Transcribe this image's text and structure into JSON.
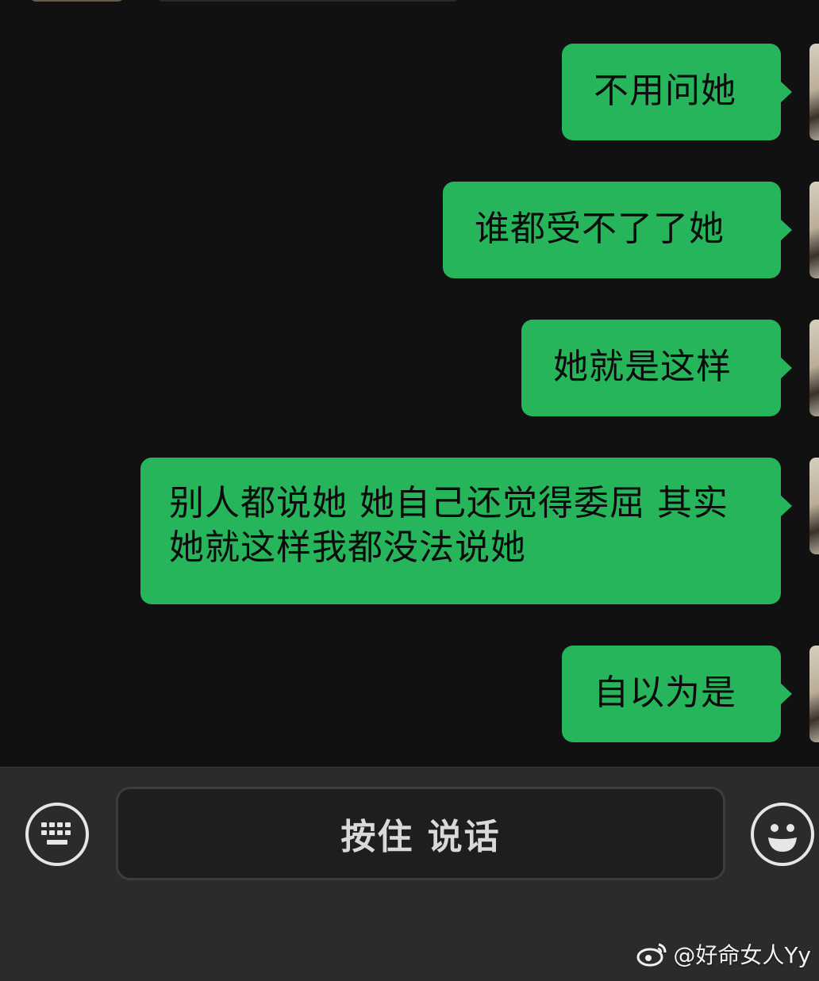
{
  "chat": {
    "messages": [
      {
        "text": "不用问她",
        "sender": "self"
      },
      {
        "text": "谁都受不了了她",
        "sender": "self"
      },
      {
        "text": "她就是这样",
        "sender": "self"
      },
      {
        "text": "别人都说她 她自己还觉得委屈 其实她就这样我都没法说她",
        "sender": "self"
      },
      {
        "text": "自以为是",
        "sender": "self"
      }
    ]
  },
  "input_bar": {
    "keyboard_icon": "keyboard-icon",
    "hold_to_talk_label": "按住 说话",
    "emoji_icon": "smiley-icon"
  },
  "watermark": {
    "text": "@好命女人Yy",
    "icon": "weibo-logo-icon"
  },
  "colors": {
    "background": "#111111",
    "bubble_self": "#26b55b",
    "input_bar": "#2b2b2b"
  }
}
